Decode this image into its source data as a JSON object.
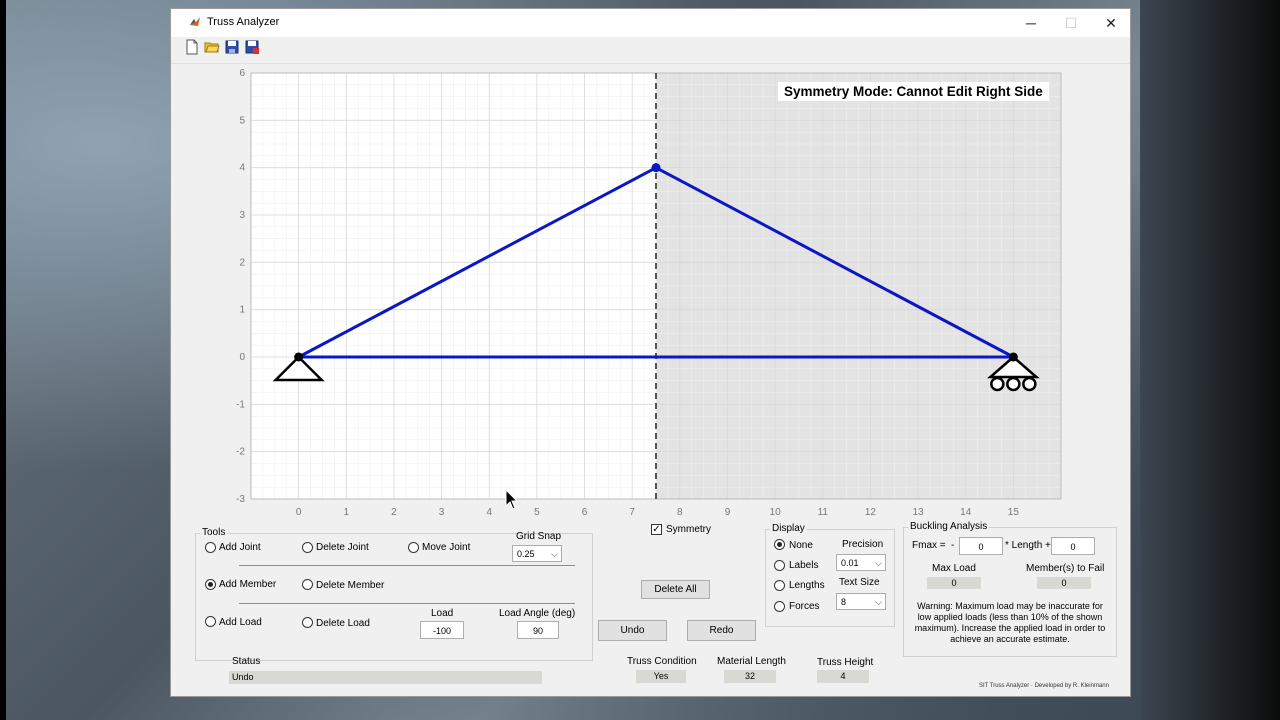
{
  "window": {
    "title": "Truss Analyzer",
    "minimize": "─",
    "maximize": "☐",
    "close": "✕"
  },
  "toolbar": {
    "new_icon": "new-file-icon",
    "open_icon": "open-folder-icon",
    "save_icon": "save-icon",
    "saveas_icon": "save-as-icon"
  },
  "plot": {
    "banner": "Symmetry Mode: Cannot Edit Right Side",
    "x_ticks": [
      "0",
      "1",
      "2",
      "3",
      "4",
      "5",
      "6",
      "7",
      "8",
      "9",
      "10",
      "11",
      "12",
      "13",
      "14",
      "15"
    ],
    "y_ticks": [
      "6",
      "5",
      "4",
      "3",
      "2",
      "1",
      "0",
      "-1",
      "-2",
      "-3"
    ],
    "xlim": [
      -1,
      16
    ],
    "ylim": [
      -3,
      6
    ],
    "symmetry_x": 7.5,
    "joints": [
      {
        "x": 0,
        "y": 0
      },
      {
        "x": 7.5,
        "y": 4
      },
      {
        "x": 15,
        "y": 0
      }
    ],
    "members": [
      [
        0,
        1
      ],
      [
        1,
        2
      ],
      [
        0,
        2
      ]
    ],
    "supports": [
      {
        "type": "pin",
        "x": 0,
        "y": 0
      },
      {
        "type": "roller",
        "x": 15,
        "y": 0
      }
    ],
    "colors": {
      "member": "#0a17c6",
      "joint": "#0a17c6",
      "support": "#000000",
      "locked_region": "#e3e3e3",
      "grid_major": "#d8d8d8",
      "grid_minor": "#efefef"
    }
  },
  "tools": {
    "title": "Tools",
    "add_joint": "Add Joint",
    "delete_joint": "Delete Joint",
    "move_joint": "Move Joint",
    "grid_snap_label": "Grid Snap",
    "grid_snap_value": "0.25",
    "add_member": "Add Member",
    "delete_member": "Delete Member",
    "add_load": "Add Load",
    "delete_load": "Delete Load",
    "load_label": "Load",
    "load_value": "-100",
    "load_angle_label": "Load Angle (deg)",
    "load_angle_value": "90"
  },
  "symmetry": {
    "label": "Symmetry",
    "checked": true
  },
  "actions": {
    "delete_all": "Delete All",
    "undo": "Undo",
    "redo": "Redo"
  },
  "display": {
    "title": "Display",
    "none": "None",
    "labels": "Labels",
    "lengths": "Lengths",
    "forces": "Forces",
    "precision_label": "Precision",
    "precision_value": "0.01",
    "text_size_label": "Text Size",
    "text_size_value": "8"
  },
  "buckling": {
    "title": "Buckling Analysis",
    "fmax_label": "Fmax =",
    "minus": "-",
    "fmax_value": "0",
    "length_label": "* Length +",
    "length_value": "0",
    "max_load_label": "Max Load",
    "max_load_value": "0",
    "members_fail_label": "Member(s) to Fail",
    "members_fail_value": "0",
    "warning": "Warning: Maximum load may be inaccurate for low applied loads (less than 10% of the shown maximum). Increase the applied load in order to achieve an accurate estimate."
  },
  "status": {
    "label": "Status",
    "value": "Undo"
  },
  "summary": {
    "truss_condition_label": "Truss Condition",
    "truss_condition_value": "Yes",
    "material_length_label": "Material Length",
    "material_length_value": "32",
    "truss_height_label": "Truss Height",
    "truss_height_value": "4"
  },
  "footer": "SIT Truss Analyzer · Developed by R. Kleinmann"
}
